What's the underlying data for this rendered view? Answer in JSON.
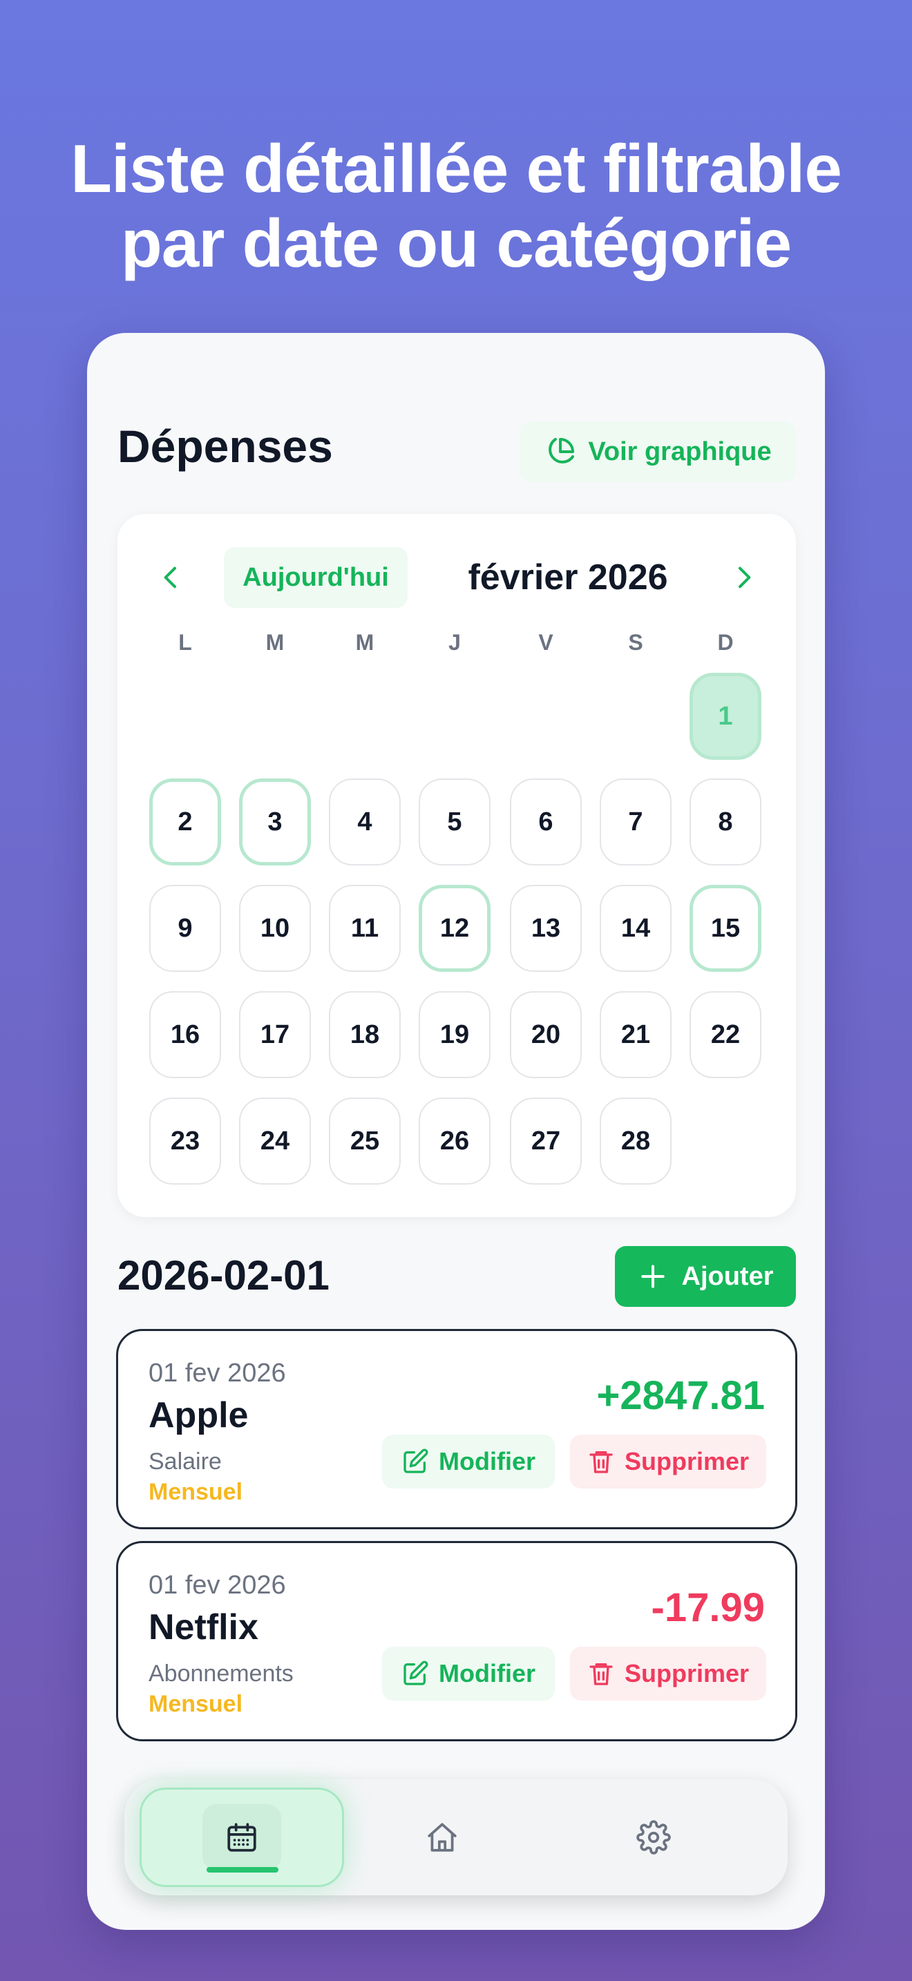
{
  "headline": {
    "line1": "Liste détaillée et filtrable",
    "line2": "par date ou catégorie"
  },
  "header": {
    "title": "Dépenses",
    "chart_button": "Voir graphique"
  },
  "calendar": {
    "today_button": "Aujourd'hui",
    "month_label": "février 2026",
    "weekdays": [
      "L",
      "M",
      "M",
      "J",
      "V",
      "S",
      "D"
    ],
    "days": [
      "1",
      "2",
      "3",
      "4",
      "5",
      "6",
      "7",
      "8",
      "9",
      "10",
      "11",
      "12",
      "13",
      "14",
      "15",
      "16",
      "17",
      "18",
      "19",
      "20",
      "21",
      "22",
      "23",
      "24",
      "25",
      "26",
      "27",
      "28"
    ],
    "selected_day": "1",
    "days_with_entries": [
      "2",
      "3",
      "12",
      "15"
    ]
  },
  "list": {
    "date_heading": "2026-02-01",
    "add_button": "Ajouter",
    "transactions": [
      {
        "date": "01 fev 2026",
        "name": "Apple",
        "category": "Salaire",
        "frequency": "Mensuel",
        "amount": "+2847.81",
        "edit_label": "Modifier",
        "delete_label": "Supprimer"
      },
      {
        "date": "01 fev 2026",
        "name": "Netflix",
        "category": "Abonnements",
        "frequency": "Mensuel",
        "amount": "-17.99",
        "edit_label": "Modifier",
        "delete_label": "Supprimer"
      }
    ]
  },
  "tabbar": {
    "active": "calendar-icon",
    "tabs": [
      "calendar-icon",
      "home-icon",
      "gear-icon"
    ]
  },
  "colors": {
    "accent": "#16b45a",
    "danger": "#ef3b5e",
    "frequency": "#f5b821"
  }
}
